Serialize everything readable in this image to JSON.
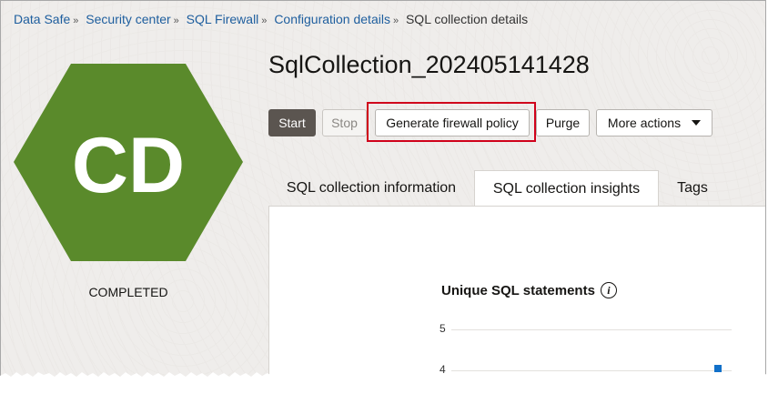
{
  "breadcrumb": {
    "items": [
      "Data Safe",
      "Security center",
      "SQL Firewall",
      "Configuration details"
    ],
    "current": "SQL collection details",
    "separator": "»"
  },
  "badge": {
    "initials": "CD",
    "color": "#5a8a2b",
    "status": "COMPLETED"
  },
  "title": "SqlCollection_202405141428",
  "toolbar": {
    "start": "Start",
    "stop": "Stop",
    "generate": "Generate firewall policy",
    "purge": "Purge",
    "more": "More actions"
  },
  "tabs": [
    "SQL collection information",
    "SQL collection insights",
    "Tags"
  ],
  "active_tab": "SQL collection insights",
  "chart": {
    "title": "Unique SQL statements",
    "info_icon": "info-icon",
    "y_ticks": [
      "5",
      "4"
    ]
  },
  "colors": {
    "highlight": "#d0021b",
    "accent_bar": "#1170c9"
  }
}
